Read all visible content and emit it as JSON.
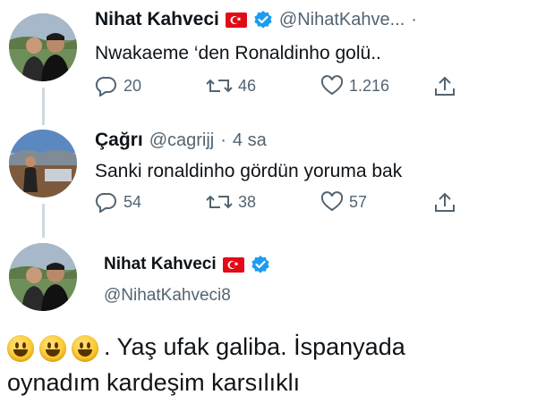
{
  "tweets": [
    {
      "name": "Nihat Kahveci",
      "handle": "@NihatKahve...",
      "dot": "·",
      "text": "Nwakaeme ‘den Ronaldinho golü..",
      "replies": "20",
      "retweets": "46",
      "likes": "1.216"
    },
    {
      "name": "Çağrı",
      "handle": "@cagrijj",
      "dot": "·",
      "time": "4 sa",
      "text": "Sanki ronaldinho gördün yoruma bak",
      "replies": "54",
      "retweets": "38",
      "likes": "57"
    }
  ],
  "main_tweet": {
    "name": "Nihat Kahveci",
    "handle": "@NihatKahveci8",
    "text_line1": ". Yaş ufak galiba. İspanyada",
    "text_line2": "oynadım kardeşim karsılıklı"
  },
  "colors": {
    "verified": "#1d9bf0",
    "flag": "#e30a17",
    "muted": "#536471"
  },
  "icons": [
    "reply-icon",
    "retweet-icon",
    "like-icon",
    "share-icon",
    "verified-icon",
    "turkey-flag-icon",
    "grinning-emoji-icon"
  ]
}
